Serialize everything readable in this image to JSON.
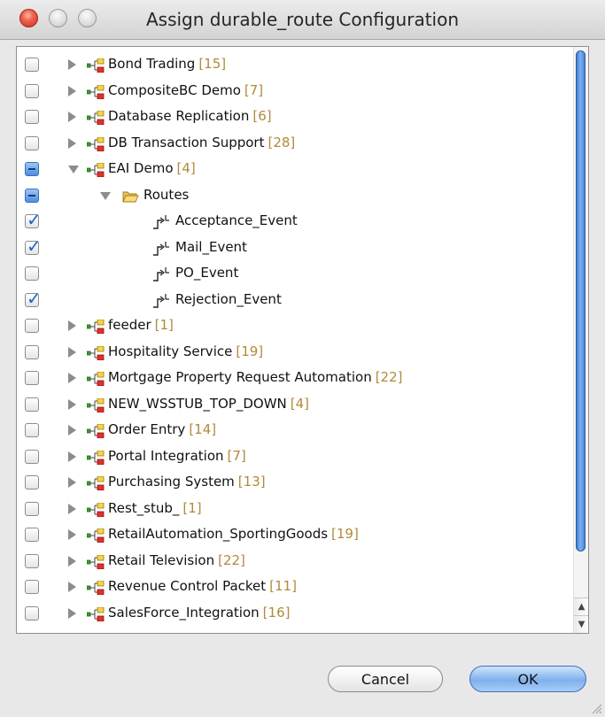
{
  "window": {
    "title": "Assign durable_route Configuration"
  },
  "tree": {
    "items": [
      {
        "label": "Bond Trading",
        "count": "[15]",
        "check": "unchecked",
        "expander": "closed",
        "kind": "project",
        "depth": 0
      },
      {
        "label": "CompositeBC Demo",
        "count": "[7]",
        "check": "unchecked",
        "expander": "closed",
        "kind": "project",
        "depth": 0
      },
      {
        "label": "Database Replication",
        "count": "[6]",
        "check": "unchecked",
        "expander": "closed",
        "kind": "project",
        "depth": 0
      },
      {
        "label": "DB Transaction Support",
        "count": "[28]",
        "check": "unchecked",
        "expander": "closed",
        "kind": "project",
        "depth": 0
      },
      {
        "label": "EAI Demo",
        "count": "[4]",
        "check": "partial",
        "expander": "open",
        "kind": "project",
        "depth": 0
      },
      {
        "label": "Routes",
        "count": "",
        "check": "partial",
        "expander": "open",
        "kind": "folder",
        "depth": 1
      },
      {
        "label": "Acceptance_Event",
        "count": "",
        "check": "checked",
        "expander": "none",
        "kind": "route",
        "depth": 2
      },
      {
        "label": "Mail_Event",
        "count": "",
        "check": "checked",
        "expander": "none",
        "kind": "route",
        "depth": 2
      },
      {
        "label": "PO_Event",
        "count": "",
        "check": "unchecked",
        "expander": "none",
        "kind": "route",
        "depth": 2
      },
      {
        "label": "Rejection_Event",
        "count": "",
        "check": "checked",
        "expander": "none",
        "kind": "route",
        "depth": 2
      },
      {
        "label": "feeder",
        "count": "[1]",
        "check": "unchecked",
        "expander": "closed",
        "kind": "project",
        "depth": 0
      },
      {
        "label": "Hospitality Service",
        "count": "[19]",
        "check": "unchecked",
        "expander": "closed",
        "kind": "project",
        "depth": 0
      },
      {
        "label": "Mortgage Property Request Automation",
        "count": "[22]",
        "check": "unchecked",
        "expander": "closed",
        "kind": "project",
        "depth": 0
      },
      {
        "label": "NEW_WSSTUB_TOP_DOWN",
        "count": "[4]",
        "check": "unchecked",
        "expander": "closed",
        "kind": "project",
        "depth": 0
      },
      {
        "label": "Order Entry",
        "count": "[14]",
        "check": "unchecked",
        "expander": "closed",
        "kind": "project",
        "depth": 0
      },
      {
        "label": "Portal Integration",
        "count": "[7]",
        "check": "unchecked",
        "expander": "closed",
        "kind": "project",
        "depth": 0
      },
      {
        "label": "Purchasing System",
        "count": "[13]",
        "check": "unchecked",
        "expander": "closed",
        "kind": "project",
        "depth": 0
      },
      {
        "label": "Rest_stub_",
        "count": "[1]",
        "check": "unchecked",
        "expander": "closed",
        "kind": "project",
        "depth": 0
      },
      {
        "label": "RetailAutomation_SportingGoods",
        "count": "[19]",
        "check": "unchecked",
        "expander": "closed",
        "kind": "project",
        "depth": 0
      },
      {
        "label": "Retail Television",
        "count": "[22]",
        "check": "unchecked",
        "expander": "closed",
        "kind": "project",
        "depth": 0
      },
      {
        "label": "Revenue Control Packet",
        "count": "[11]",
        "check": "unchecked",
        "expander": "closed",
        "kind": "project",
        "depth": 0
      },
      {
        "label": "SalesForce_Integration",
        "count": "[16]",
        "check": "unchecked",
        "expander": "closed",
        "kind": "project",
        "depth": 0
      }
    ]
  },
  "icons": {
    "project": "project-tree-icon",
    "folder": "open-folder-icon",
    "route": "route-icon",
    "close": "close-icon",
    "minimize": "minimize-icon",
    "zoom": "zoom-icon"
  },
  "colors": {
    "count_text": "#b08a3a",
    "accent": "#3d7ed6",
    "close_red": "#e0443a"
  },
  "buttons": {
    "cancel_label": "Cancel",
    "ok_label": "OK"
  }
}
